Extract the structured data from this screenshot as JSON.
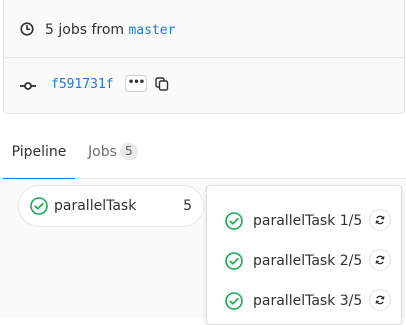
{
  "pipeline_info": {
    "jobs_count_text": "5 jobs from",
    "branch": "master",
    "commit_sha": "f591731f",
    "ellipsis_label": "•••"
  },
  "tabs": [
    {
      "label": "Pipeline",
      "active": true
    },
    {
      "label": "Jobs",
      "badge": "5",
      "active": false
    }
  ],
  "stage": {
    "name": "parallelTask",
    "count": "5",
    "status": "success"
  },
  "jobs_dropdown": [
    {
      "name": "parallelTask 1/5",
      "status": "success",
      "action_icon": "retry-icon"
    },
    {
      "name": "parallelTask 2/5",
      "status": "success",
      "action_icon": "retry-icon"
    },
    {
      "name": "parallelTask 3/5",
      "status": "success",
      "action_icon": "retry-icon"
    }
  ],
  "colors": {
    "success": "#1aaa55",
    "link": "#1f78d1",
    "active_tab": "#1f78d1"
  }
}
